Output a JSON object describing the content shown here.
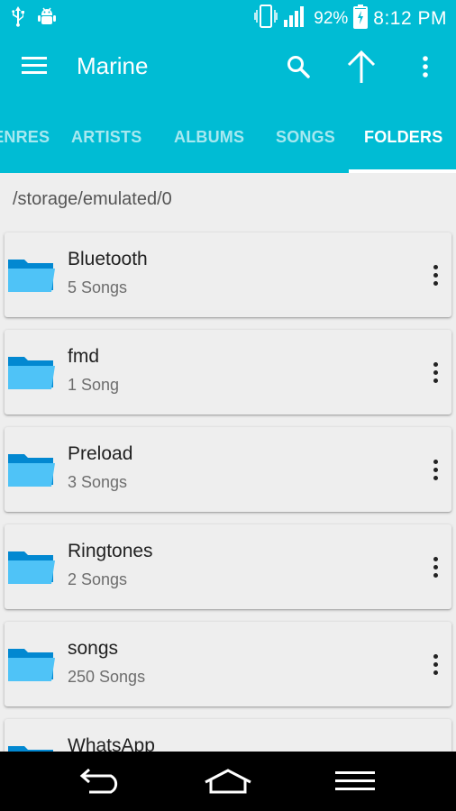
{
  "status_bar": {
    "battery": "92%",
    "time": "8:12 PM",
    "icons": [
      "usb-icon",
      "android-debug-icon",
      "vibrate-icon",
      "signal-icon",
      "battery-charging-icon"
    ]
  },
  "app_bar": {
    "title": "Marine",
    "actions": [
      "search-icon",
      "arrow-up-icon",
      "more-vert-icon"
    ]
  },
  "tabs": [
    {
      "label": "GENRES",
      "active": false
    },
    {
      "label": "ARTISTS",
      "active": false
    },
    {
      "label": "ALBUMS",
      "active": false
    },
    {
      "label": "SONGS",
      "active": false
    },
    {
      "label": "FOLDERS",
      "active": true
    }
  ],
  "path": "/storage/emulated/0",
  "folders": [
    {
      "name": "Bluetooth",
      "count": "5 Songs"
    },
    {
      "name": "fmd",
      "count": "1 Song"
    },
    {
      "name": "Preload",
      "count": "3 Songs"
    },
    {
      "name": "Ringtones",
      "count": "2 Songs"
    },
    {
      "name": "songs",
      "count": "250 Songs"
    },
    {
      "name": "WhatsApp",
      "count": ""
    }
  ],
  "nav_bar": [
    "back-icon",
    "home-icon",
    "recents-menu-icon"
  ],
  "colors": {
    "primary": "#00bcd4",
    "folder": "#4fc3f7",
    "folder_dark": "#0288d1",
    "background": "#eeeeee"
  }
}
